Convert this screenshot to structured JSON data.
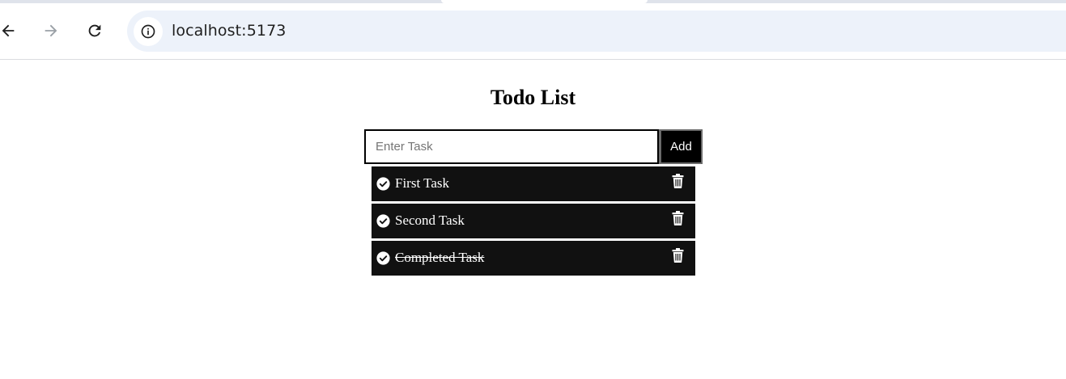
{
  "browser": {
    "url": "localhost:5173",
    "icons": {
      "back": "arrow-left-icon",
      "forward": "arrow-right-icon",
      "reload": "reload-icon",
      "site_info": "info-icon"
    }
  },
  "app": {
    "title": "Todo List",
    "input": {
      "placeholder": "Enter Task",
      "value": ""
    },
    "add_label": "Add",
    "tasks": [
      {
        "text": "First Task",
        "completed": false
      },
      {
        "text": "Second Task",
        "completed": false
      },
      {
        "text": "Completed Task",
        "completed": true
      }
    ],
    "colors": {
      "task_background": "#111111",
      "task_text": "#ffffff",
      "button_background": "#000000"
    }
  }
}
